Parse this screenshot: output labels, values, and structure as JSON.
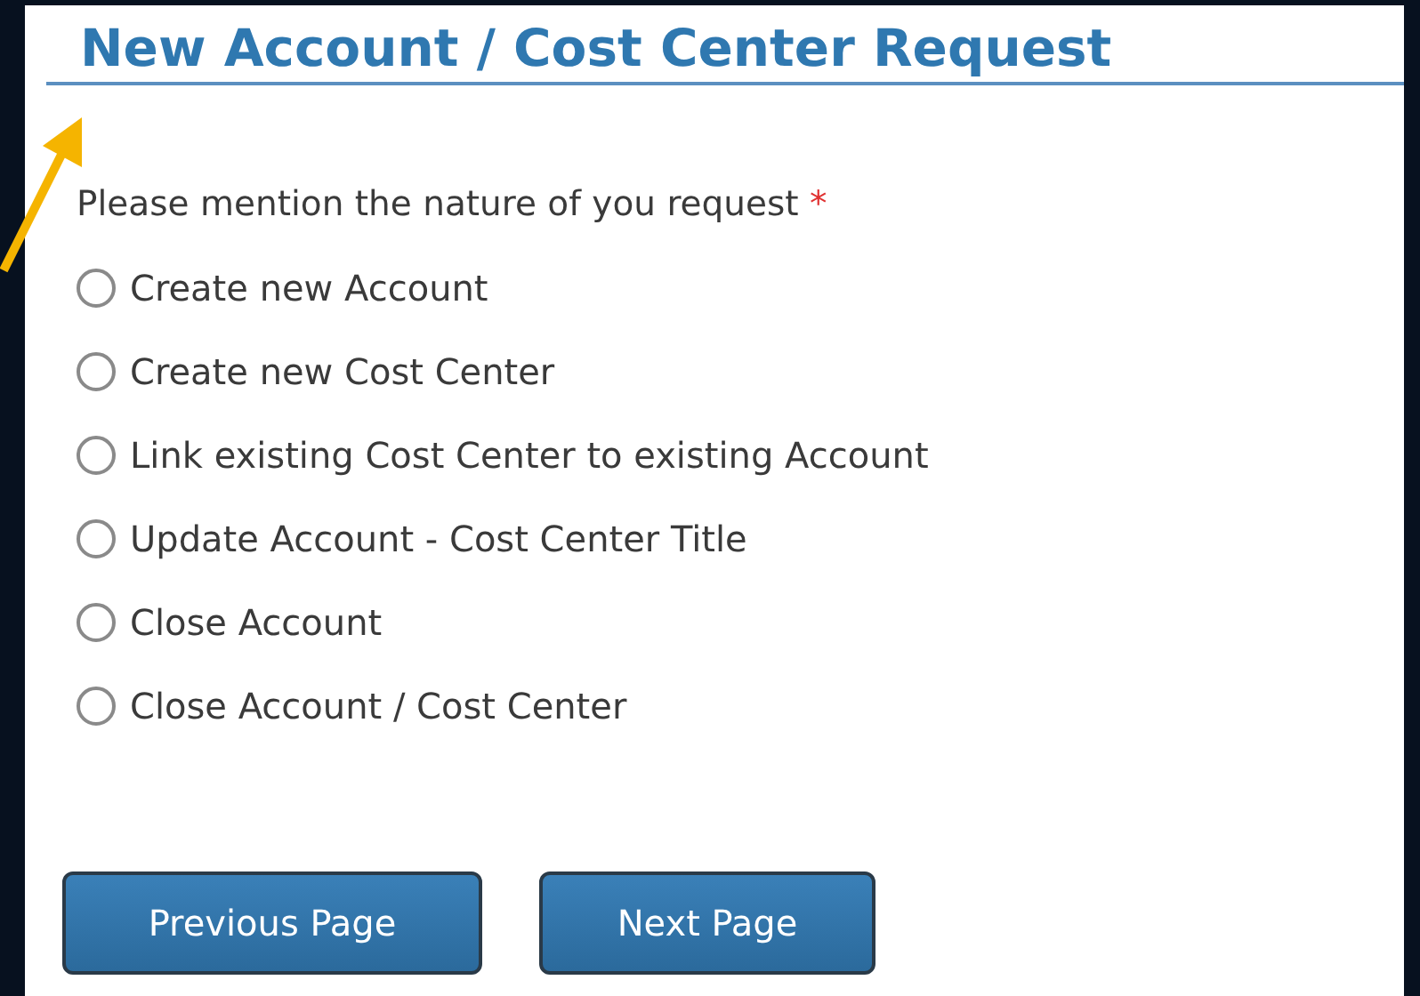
{
  "title": "New Account / Cost Center Request",
  "question": {
    "label": "Please mention the nature of you request",
    "required_mark": "*"
  },
  "options": [
    {
      "label": "Create new Account",
      "selected": false
    },
    {
      "label": "Create new Cost Center",
      "selected": false
    },
    {
      "label": "Link existing Cost Center to existing Account",
      "selected": false
    },
    {
      "label": "Update Account - Cost Center Title",
      "selected": false
    },
    {
      "label": "Close Account",
      "selected": false
    },
    {
      "label": "Close Account / Cost Center",
      "selected": false
    }
  ],
  "buttons": [
    "Previous Page",
    "Next Page"
  ]
}
